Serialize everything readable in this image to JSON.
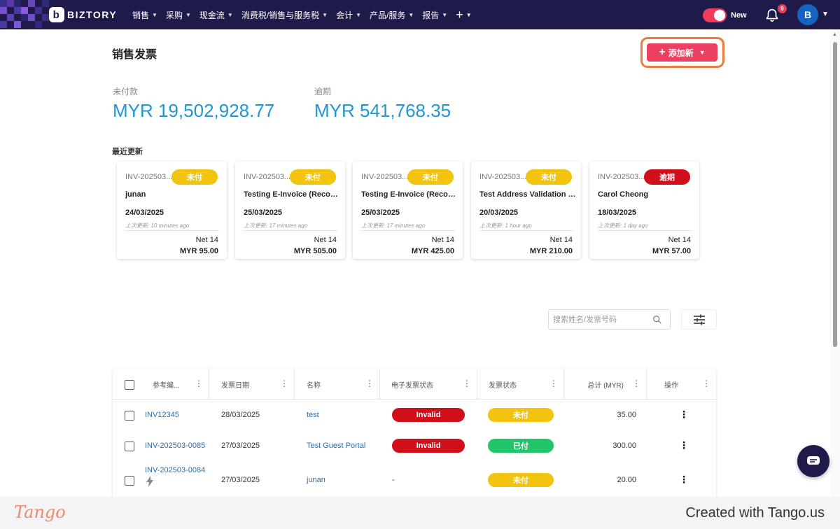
{
  "nav": {
    "brand": "BIZTORY",
    "logo_letter": "b",
    "menu": [
      "销售",
      "采购",
      "现金流",
      "消费税/销售与服务税",
      "会计",
      "产品/服务",
      "报告"
    ],
    "plus": "+",
    "toggle_label": "New",
    "notifications": "9",
    "avatar": "B"
  },
  "page": {
    "title": "销售发票",
    "add_new": "添加新",
    "unpaid_label": "未付款",
    "unpaid_value": "MYR 19,502,928.77",
    "overdue_label": "逾期",
    "overdue_value": "MYR 541,768.35",
    "recent_label": "最近更新"
  },
  "cards": [
    {
      "ref": "INV-202503...",
      "status": "未付",
      "status_color": "#f2c40f",
      "name": "junan",
      "date": "24/03/2025",
      "updated": "上次更新: 10 minutes ago",
      "terms": "Net 14",
      "amount": "MYR 95.00"
    },
    {
      "ref": "INV-202503...",
      "status": "未付",
      "status_color": "#f2c40f",
      "name": "Testing E-Invoice (Record)",
      "date": "25/03/2025",
      "updated": "上次更新: 17 minutes ago",
      "terms": "Net 14",
      "amount": "MYR 505.00"
    },
    {
      "ref": "INV-202503...",
      "status": "未付",
      "status_color": "#f2c40f",
      "name": "Testing E-Invoice (Record)",
      "date": "25/03/2025",
      "updated": "上次更新: 17 minutes ago",
      "terms": "Net 14",
      "amount": "MYR 425.00"
    },
    {
      "ref": "INV-202503...",
      "status": "未付",
      "status_color": "#f2c40f",
      "name": "Test Address Validation (...",
      "date": "20/03/2025",
      "updated": "上次更新: 1 hour ago",
      "terms": "Net 14",
      "amount": "MYR 210.00"
    },
    {
      "ref": "INV-202503...",
      "status": "逾期",
      "status_color": "#d00f1a",
      "name": "Carol Cheong",
      "date": "18/03/2025",
      "updated": "上次更新: 1 day ago",
      "terms": "Net 14",
      "amount": "MYR 57.00"
    }
  ],
  "search": {
    "placeholder": "搜索姓名/发票号码"
  },
  "table": {
    "headers": [
      "参考编...",
      "发票日期",
      "名称",
      "电子发票状态",
      "发票状态",
      "总计 (MYR)",
      "操作"
    ],
    "rows": [
      {
        "ref": "INV12345",
        "date": "28/03/2025",
        "name": "test",
        "einvoice": "Invalid",
        "status": "未付",
        "total": "35.00"
      },
      {
        "ref": "INV-202503-0085",
        "date": "27/03/2025",
        "name": "Test Guest Portal",
        "einvoice": "Invalid",
        "status": "已付",
        "total": "300.00"
      },
      {
        "ref": "INV-202503-0084",
        "date": "27/03/2025",
        "name": "junan",
        "einvoice": "-",
        "status": "未付",
        "total": "20.00"
      }
    ]
  },
  "footer": {
    "logo": "Tango",
    "credit": "Created with Tango.us"
  },
  "colors": {
    "nav_bg": "#1e1b4b",
    "accent_pink": "#ec3f64",
    "amount_blue": "#2196d3",
    "link_blue": "#2c6ca8",
    "paid_green": "#21c56a",
    "unpaid_yellow": "#f2c40f",
    "invalid_red": "#d00f1a",
    "highlight_orange": "#f07a3c"
  }
}
